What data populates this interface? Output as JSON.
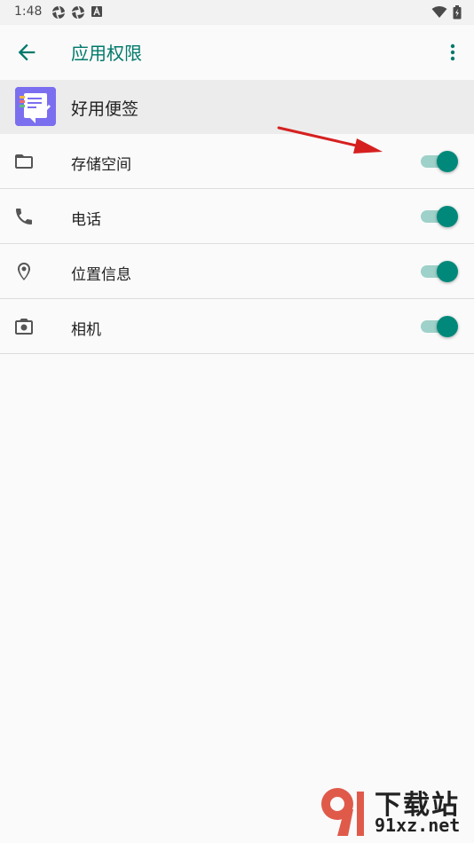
{
  "status_bar": {
    "time": "1:48",
    "left_icons": [
      "aperture-icon",
      "aperture-icon",
      "a-square-icon"
    ],
    "right_icons": [
      "wifi-icon",
      "battery-icon"
    ]
  },
  "app_bar": {
    "title": "应用权限",
    "accent_color": "#00796b"
  },
  "app": {
    "name": "好用便签",
    "icon_color": "#7b6ff0"
  },
  "permissions": [
    {
      "label": "存储空间",
      "icon": "folder-icon",
      "enabled": true
    },
    {
      "label": "电话",
      "icon": "phone-icon",
      "enabled": true
    },
    {
      "label": "位置信息",
      "icon": "location-pin-icon",
      "enabled": true
    },
    {
      "label": "相机",
      "icon": "camera-icon",
      "enabled": true
    }
  ],
  "watermark": {
    "text": "下载站",
    "url": "91xz.net"
  }
}
